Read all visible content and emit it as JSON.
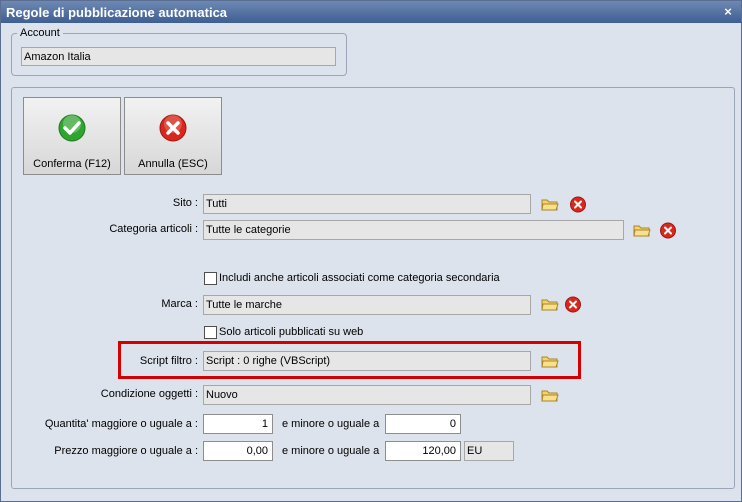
{
  "window": {
    "title": "Regole di pubblicazione automatica",
    "close_glyph": "×"
  },
  "account": {
    "legend": "Account",
    "value": "Amazon Italia"
  },
  "buttons": {
    "confirm_label": "Conferma (F12)",
    "cancel_label": "Annulla (ESC)"
  },
  "fields": {
    "sito": {
      "label": "Sito :",
      "value": "Tutti"
    },
    "categoria": {
      "label": "Categoria articoli :",
      "value": "Tutte le categorie"
    },
    "secondaria": {
      "label": "Includi anche articoli associati come categoria secondaria",
      "checked": false
    },
    "marca": {
      "label": "Marca :",
      "value": "Tutte le marche"
    },
    "web": {
      "label": "Solo articoli pubblicati su web",
      "checked": false
    },
    "script": {
      "label": "Script filtro :",
      "value": "Script : 0 righe (VBScript)"
    },
    "condizione": {
      "label": "Condizione oggetti :",
      "value": "Nuovo"
    },
    "quantita": {
      "label": "Quantita' maggiore o uguale a :",
      "min": "1",
      "between": "e minore o uguale a",
      "max": "0"
    },
    "prezzo": {
      "label": "Prezzo maggiore o uguale a :",
      "min": "0,00",
      "between": "e minore o uguale a",
      "max": "120,00",
      "currency": "EU"
    }
  },
  "colors": {
    "title_bar": "#3f5e92",
    "highlight": "#d40000",
    "confirm_green": "#2fa52f",
    "cancel_red": "#d8271c"
  },
  "icons": [
    "check-icon",
    "cancel-x-icon",
    "folder-icon",
    "clear-icon",
    "close-icon"
  ]
}
